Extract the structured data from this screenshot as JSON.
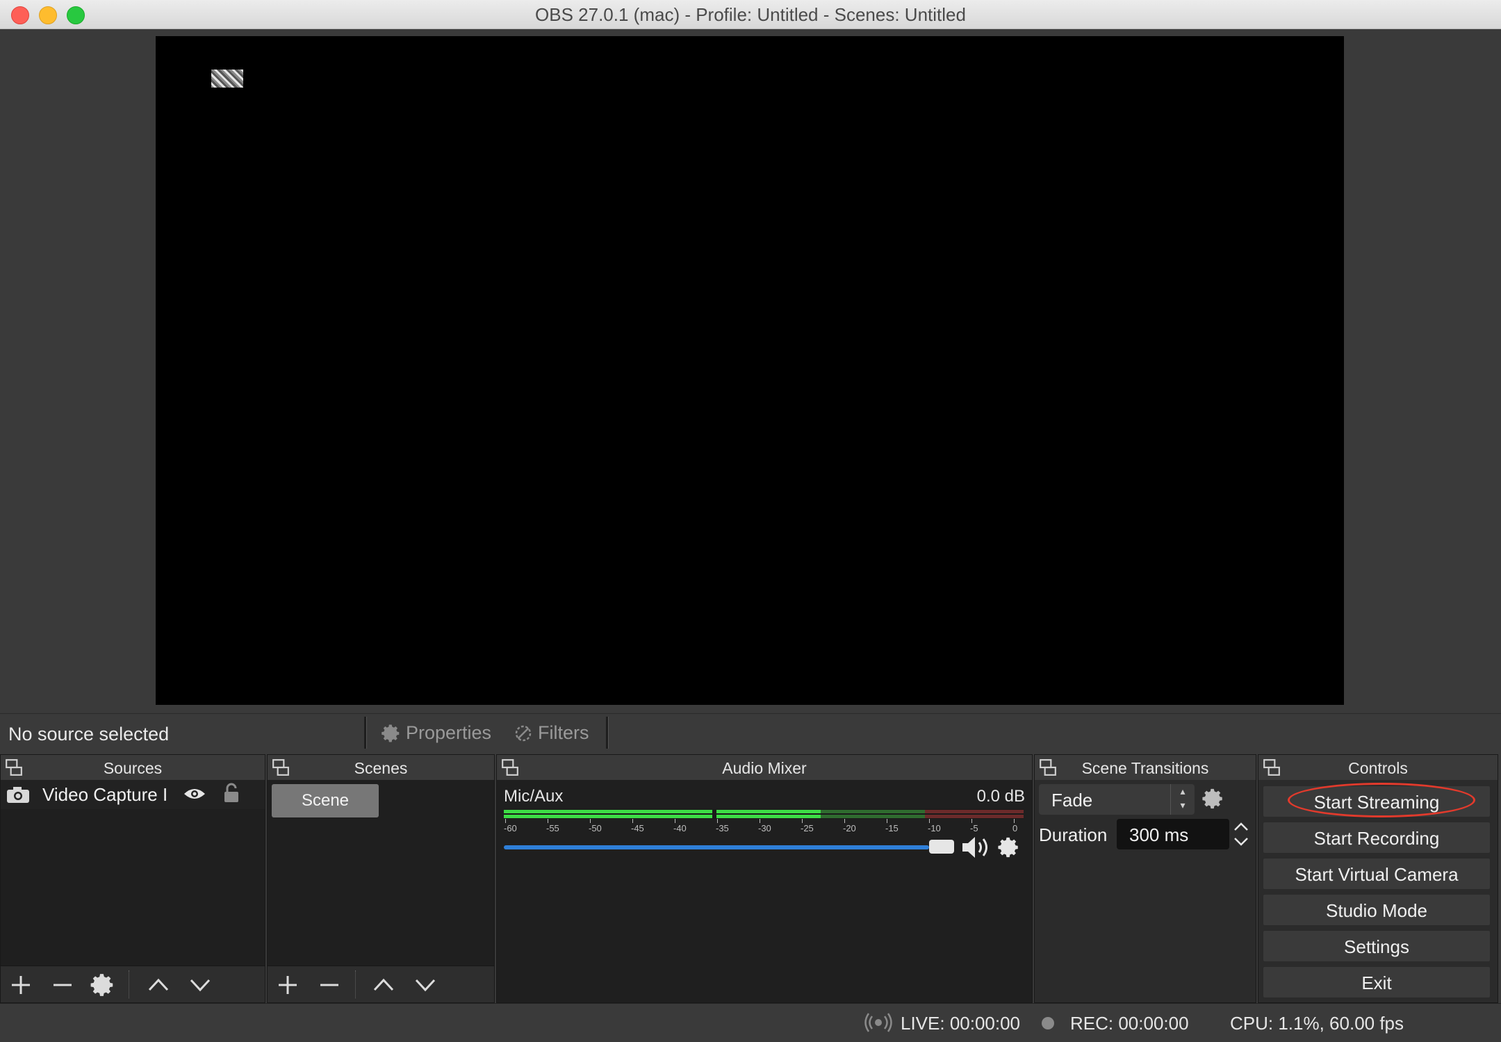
{
  "window": {
    "title": "OBS 27.0.1 (mac) - Profile: Untitled - Scenes: Untitled"
  },
  "source_toolbar": {
    "status": "No source selected",
    "properties_label": "Properties",
    "filters_label": "Filters"
  },
  "docks": {
    "sources": {
      "title": "Sources",
      "items": [
        {
          "name": "Video Capture I"
        }
      ]
    },
    "scenes": {
      "title": "Scenes",
      "items": [
        {
          "name": "Scene"
        }
      ]
    },
    "audio_mixer": {
      "title": "Audio Mixer",
      "channels": [
        {
          "name": "Mic/Aux",
          "level": "0.0 dB",
          "volume_fraction": 1.0
        }
      ],
      "meter_ticks": [
        "-60",
        "-55",
        "-50",
        "-45",
        "-40",
        "-35",
        "-30",
        "-25",
        "-20",
        "-15",
        "-10",
        "-5",
        "0"
      ]
    },
    "scene_transitions": {
      "title": "Scene Transitions",
      "transition": "Fade",
      "duration_label": "Duration",
      "duration_value": "300 ms"
    },
    "controls": {
      "title": "Controls",
      "buttons": [
        "Start Streaming",
        "Start Recording",
        "Start Virtual Camera",
        "Studio Mode",
        "Settings",
        "Exit"
      ]
    }
  },
  "status": {
    "live": "LIVE: 00:00:00",
    "rec": "REC: 00:00:00",
    "cpu": "CPU: 1.1%, 60.00 fps"
  },
  "colors": {
    "accent_blue": "#2f7fd8",
    "meter_green": "#3ddc45",
    "annotation_red": "#e23a2c"
  }
}
